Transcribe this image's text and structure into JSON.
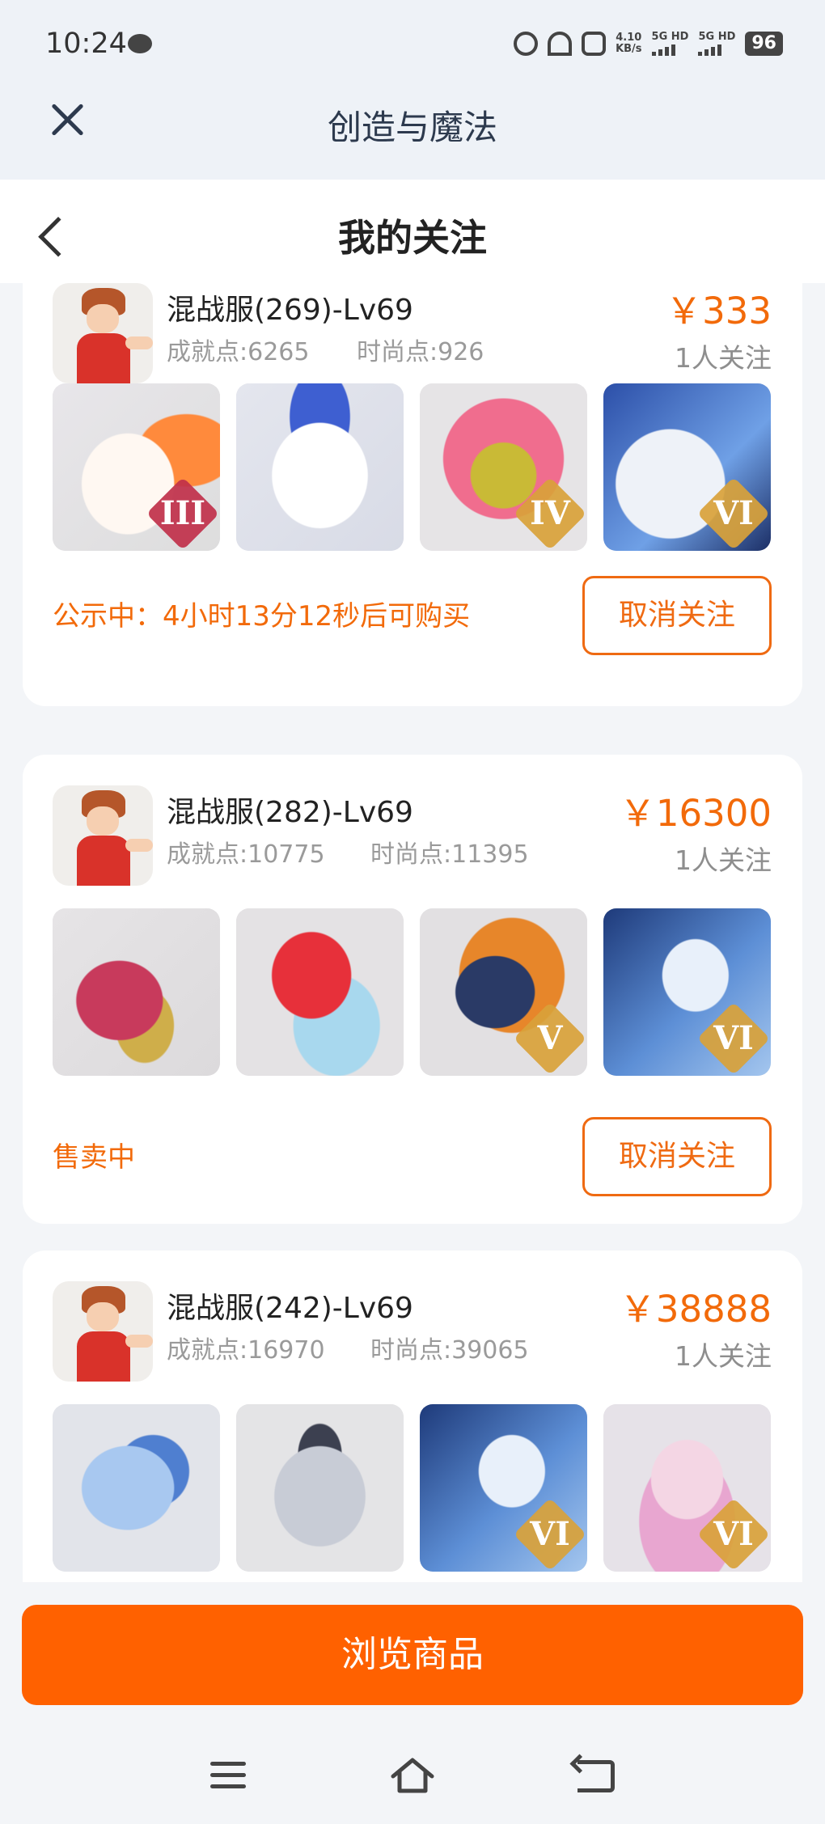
{
  "status_bar": {
    "time": "10:24",
    "speed_value": "4.10",
    "speed_unit": "KB/s",
    "network_1": "5G HD",
    "network_2": "5G HD",
    "battery": "96"
  },
  "app_title": "创造与魔法",
  "page_title": "我的关注",
  "cards": [
    {
      "server": "混战服(269)-Lv69",
      "achievement": "成就点:6265",
      "fashion": "时尚点:926",
      "price": "￥333",
      "followers": "1人关注",
      "status": "公示中：4小时13分12秒后可购买",
      "unfollow_label": "取消关注",
      "items": [
        {
          "name": "unicorn-mount-icon",
          "tier": "III",
          "badge_color": "#c0304a"
        },
        {
          "name": "owl-mount-icon",
          "tier": "",
          "badge_color": ""
        },
        {
          "name": "pink-bear-icon",
          "tier": "IV",
          "badge_color": "#d9a23a"
        },
        {
          "name": "white-tiger-icon",
          "tier": "VI",
          "badge_color": "#d9a23a"
        }
      ]
    },
    {
      "server": "混战服(282)-Lv69",
      "achievement": "成就点:10775",
      "fashion": "时尚点:11395",
      "price": "￥16300",
      "followers": "1人关注",
      "status": "售卖中",
      "unfollow_label": "取消关注",
      "items": [
        {
          "name": "dragon-mount-icon",
          "tier": "",
          "badge_color": ""
        },
        {
          "name": "red-fish-mount-icon",
          "tier": "",
          "badge_color": ""
        },
        {
          "name": "fire-dragon-icon",
          "tier": "V",
          "badge_color": "#d9a23a"
        },
        {
          "name": "ice-warrior-icon",
          "tier": "VI",
          "badge_color": "#d9a23a"
        }
      ]
    },
    {
      "server": "混战服(242)-Lv69",
      "achievement": "成就点:16970",
      "fashion": "时尚点:39065",
      "price": "￥38888",
      "followers": "1人关注",
      "items": [
        {
          "name": "blue-dragon-icon",
          "tier": "",
          "badge_color": ""
        },
        {
          "name": "silver-dragon-icon",
          "tier": "",
          "badge_color": ""
        },
        {
          "name": "ice-warrior-icon",
          "tier": "VI",
          "badge_color": "#d9a23a"
        },
        {
          "name": "fox-girl-icon",
          "tier": "VI",
          "badge_color": "#d9a23a"
        }
      ]
    }
  ],
  "browse_button": "浏览商品"
}
